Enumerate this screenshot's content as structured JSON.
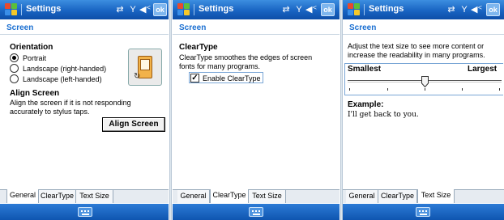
{
  "titlebar": {
    "title": "Settings",
    "ok_label": "ok"
  },
  "status_icons": [
    "connectivity-icon",
    "signal-icon",
    "speaker-icon"
  ],
  "colors": {
    "titlebar": "#1964c2",
    "section_header": "#1a6fd1"
  },
  "panels": [
    {
      "section_header": "Screen",
      "orientation": {
        "heading": "Orientation",
        "options": [
          "Portrait",
          "Landscape (right-handed)",
          "Landscape (left-handed)"
        ],
        "selected": "Portrait"
      },
      "align": {
        "heading": "Align Screen",
        "description_line1": "Align the screen if it is not responding",
        "description_line2": "accurately to stylus taps.",
        "button_label": "Align Screen"
      },
      "active_tab": "General"
    },
    {
      "section_header": "Screen",
      "cleartype": {
        "heading": "ClearType",
        "description_line1": "ClearType smoothes the edges of screen",
        "description_line2": "fonts for many programs.",
        "checkbox_label": "Enable ClearType",
        "checked": true
      },
      "active_tab": "ClearType"
    },
    {
      "section_header": "Screen",
      "textsize": {
        "description_line1": "Adjust the text size to see more content or",
        "description_line2": "increase the readability in many programs.",
        "min_label": "Smallest",
        "max_label": "Largest",
        "slider_position": 0.5,
        "example_heading": "Example:",
        "example_text": "I'll get back to you."
      },
      "active_tab": "Text Size"
    }
  ],
  "tabs": [
    "General",
    "ClearType",
    "Text Size"
  ]
}
